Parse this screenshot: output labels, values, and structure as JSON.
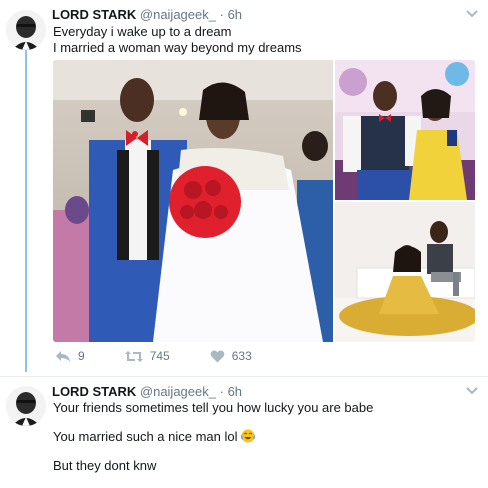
{
  "tweets": [
    {
      "name": "LORD STARK",
      "handle": "@naijageek_",
      "separator": "·",
      "time": "6h",
      "lines": [
        "Everyday i wake up to a dream",
        "I married a woman way beyond my dreams"
      ],
      "actions": {
        "replies": "9",
        "retweets": "745",
        "likes": "633"
      }
    },
    {
      "name": "LORD STARK",
      "handle": "@naijageek_",
      "separator": "·",
      "time": "6h",
      "lines": [
        "Your friends sometimes tell you how lucky you are babe",
        "You married such a nice man lol",
        "But they dont knw"
      ]
    }
  ],
  "colors": {
    "thread_line": "#8fc2ea",
    "action_gray": "#aab8c2",
    "text": "#14171a",
    "meta": "#657786"
  },
  "icons": [
    "avatar",
    "chevron-down-icon",
    "reply-icon",
    "retweet-icon",
    "heart-icon",
    "face-with-tears-of-joy-emoji"
  ]
}
